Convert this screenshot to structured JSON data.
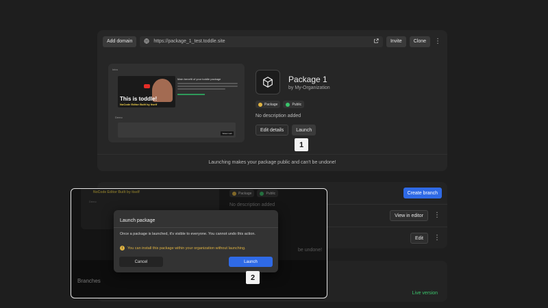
{
  "toolbar": {
    "add_domain": "Add domain",
    "url": "https://package_1_test.toddle.site",
    "invite": "Invite",
    "clone": "Clone"
  },
  "preview": {
    "intro_label": "Intro",
    "video_title": "This is toddle!",
    "video_subtitle": "NoCode Editor Built by itself",
    "text_heading": "Main benefit of your toddle package",
    "demo_label": "Demo",
    "demo_tag": "Watermark"
  },
  "package": {
    "name": "Package 1",
    "org": "by My-Organization",
    "badge_package": "Package",
    "badge_public": "Public",
    "description": "No description added",
    "edit_details": "Edit details",
    "launch": "Launch",
    "warning": "Launching makes your package public and can't be undone!"
  },
  "steps": {
    "one": "1",
    "two": "2"
  },
  "list": {
    "create_branch": "Create branch",
    "view_in_editor": "View in editor",
    "edit": "Edit"
  },
  "background": {
    "video_subtitle": "NoCode Editor Built by itself",
    "demo_label": "Demo",
    "badge_package": "Package",
    "badge_public": "Public",
    "description": "No description added",
    "warning_fragment": "be undone!",
    "branches": "Branches",
    "live_version": "Live version"
  },
  "modal": {
    "title": "Launch package",
    "body": "Once a package is launched, it's visible to everyone. You cannot undo this action.",
    "info": "You can install this package within your organization without launching.",
    "cancel": "Cancel",
    "launch": "Launch"
  },
  "colors": {
    "accent": "#2f6ae6",
    "warning": "#e0b341",
    "success": "#3ac46b"
  }
}
